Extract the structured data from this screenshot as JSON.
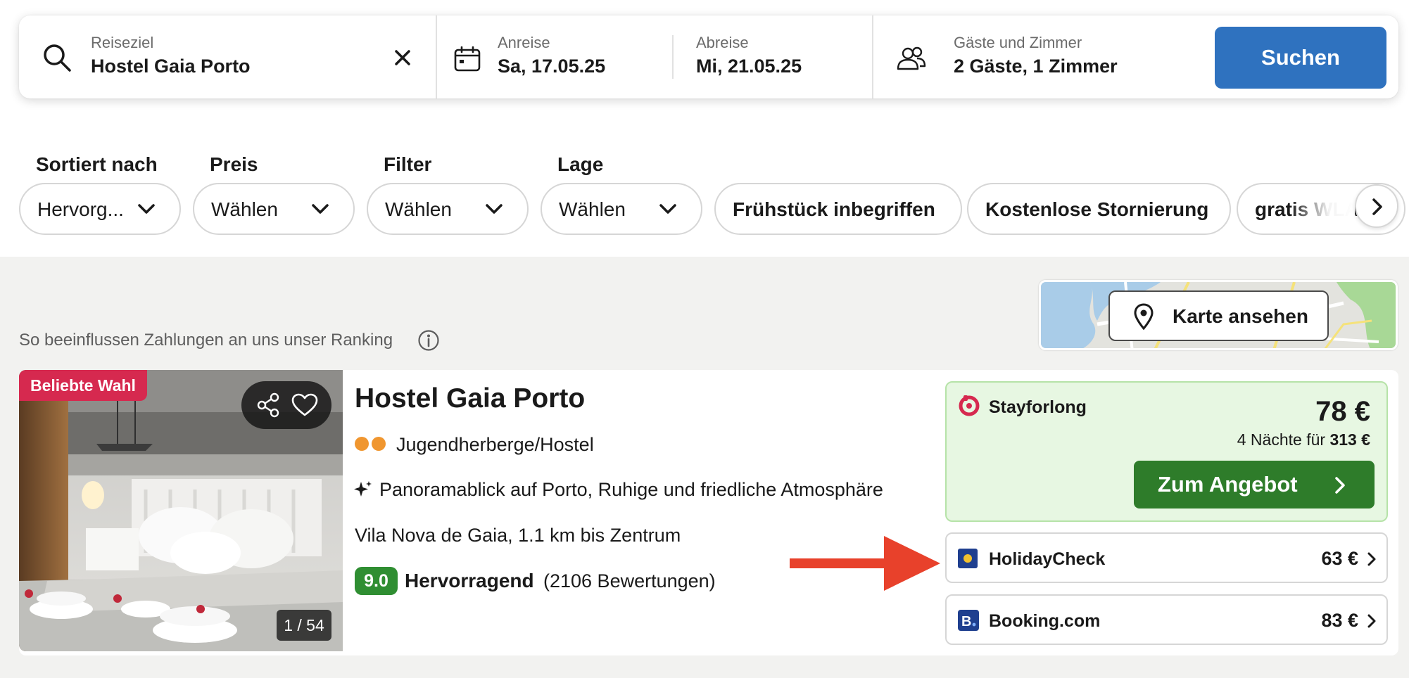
{
  "search": {
    "destination_label": "Reiseziel",
    "destination_value": "Hostel Gaia Porto",
    "checkin_label": "Anreise",
    "checkin_value": "Sa, 17.05.25",
    "checkout_label": "Abreise",
    "checkout_value": "Mi, 21.05.25",
    "guests_label": "Gäste und Zimmer",
    "guests_value": "2 Gäste, 1 Zimmer",
    "search_button": "Suchen"
  },
  "filters": {
    "selects": [
      {
        "label": "Sortiert nach",
        "value": "Hervorg..."
      },
      {
        "label": "Preis",
        "value": "Wählen"
      },
      {
        "label": "Filter",
        "value": "Wählen"
      },
      {
        "label": "Lage",
        "value": "Wählen"
      }
    ],
    "chips": [
      "Frühstück inbegriffen",
      "Kostenlose Stornierung",
      "gratis WLAN"
    ]
  },
  "ranking_note": "So beeinflussen Zahlungen an uns unser Ranking",
  "map_button": "Karte ansehen",
  "hotel": {
    "badge": "Beliebte Wahl",
    "photo_counter": "1 / 54",
    "name": "Hostel Gaia Porto",
    "type": "Jugendherberge/Hostel",
    "highlights": "Panoramablick auf Porto, Ruhige und friedliche Atmosphäre",
    "location": "Vila Nova de Gaia, 1.1 km bis Zentrum",
    "score": "9.0",
    "rating_word": "Hervorragend",
    "rating_count": "(2106 Bewertungen)",
    "hostel_stars": 2
  },
  "offers": {
    "main": {
      "provider": "Stayforlong",
      "price": "78 €",
      "total_prefix": "4 Nächte für",
      "total_value": "313 €",
      "button": "Zum Angebot"
    },
    "others": [
      {
        "provider": "HolidayCheck",
        "price": "63 €"
      },
      {
        "provider": "Booking.com",
        "price": "83 €"
      }
    ]
  },
  "colors": {
    "accent_blue": "#2f72bf",
    "offer_green": "#2e7c2a",
    "score_green": "#2f8e32",
    "badge_red": "#d6294f",
    "annotation_arrow": "#e8412b"
  }
}
